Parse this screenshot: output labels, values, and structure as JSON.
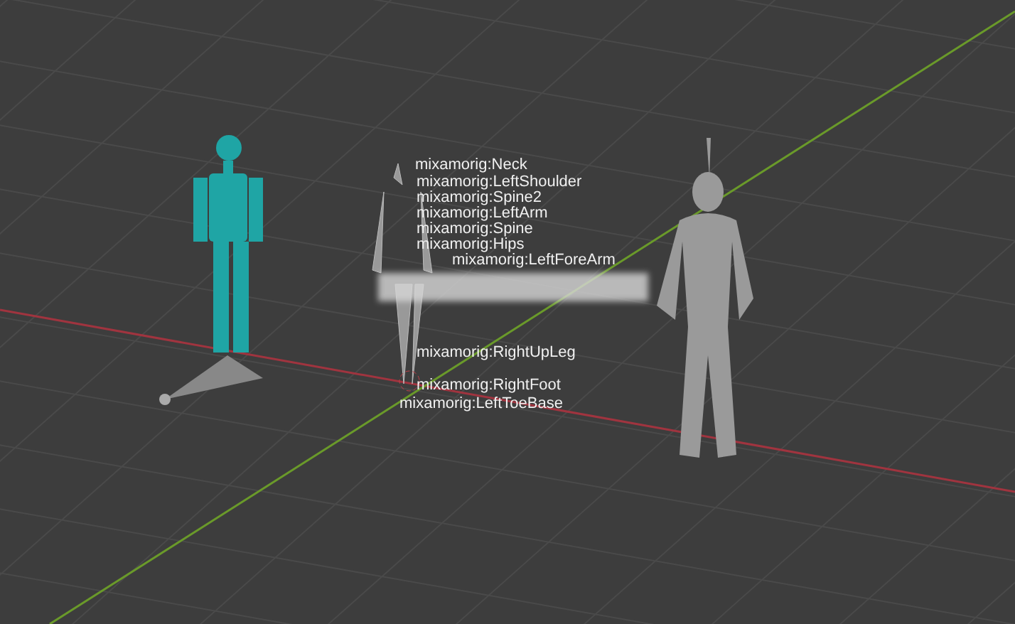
{
  "viewport": {
    "bone_labels": [
      {
        "text": "mixamorig:Neck"
      },
      {
        "text": "mixamorig:LeftShoulder"
      },
      {
        "text": "mixamorig:Spine2"
      },
      {
        "text": "mixamorig:LeftArm"
      },
      {
        "text": "mixamorig:Spine"
      },
      {
        "text": "mixamorig:Hips"
      },
      {
        "text": "mixamorig:LeftForeArm"
      },
      {
        "text": "mixamorig:RightUpLeg"
      },
      {
        "text": "mixamorig:RightFoot"
      },
      {
        "text": "mixamorig:LeftToeBase"
      }
    ]
  }
}
